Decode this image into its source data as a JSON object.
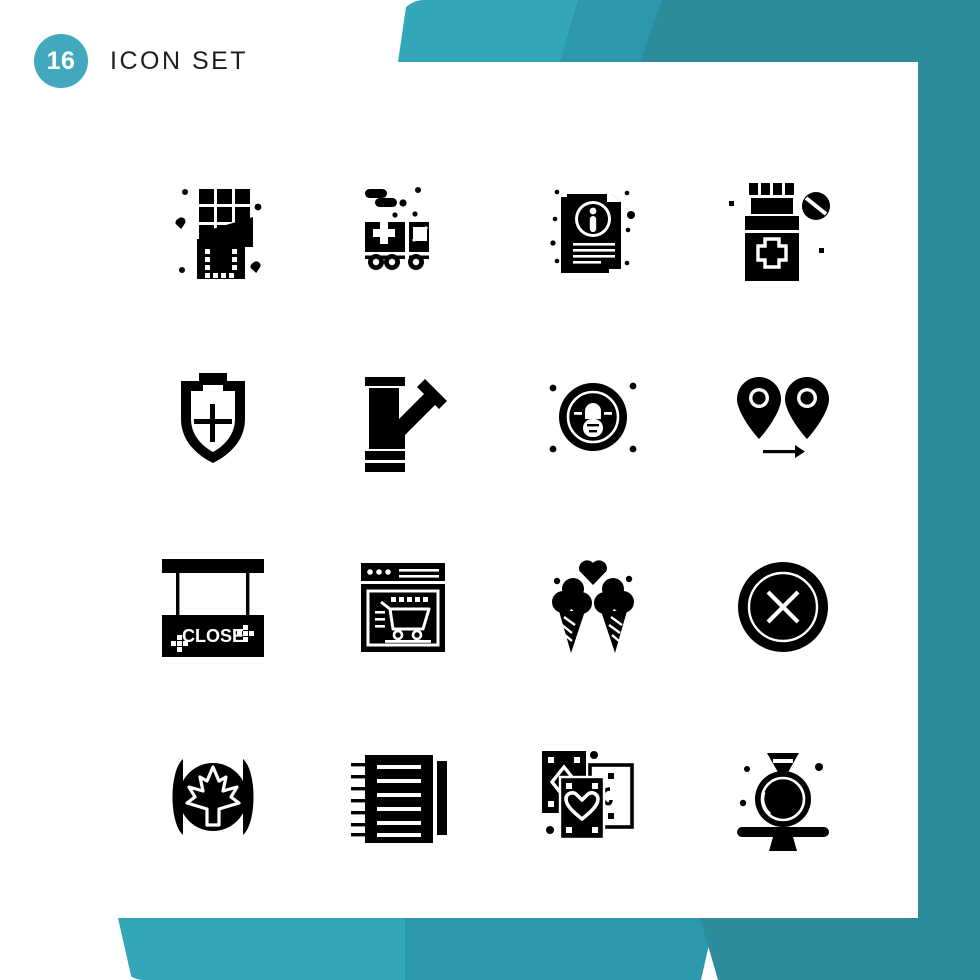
{
  "header": {
    "count": "16",
    "title": "Icon Set"
  },
  "theme": {
    "teal_light": "#33a6b8",
    "teal_mid": "#2b99ab",
    "teal_dark": "#2c8c9c",
    "badge": "#42a8bd",
    "icon_color": "#000000",
    "background": "#ffffff"
  },
  "grid": {
    "columns": 4,
    "rows": 4,
    "icons": [
      {
        "index": 1,
        "name": "chocolate-bar-icon",
        "label": "Chocolate Bar"
      },
      {
        "index": 2,
        "name": "ambulance-icon",
        "label": "Ambulance"
      },
      {
        "index": 3,
        "name": "info-document-icon",
        "label": "Information Document"
      },
      {
        "index": 4,
        "name": "medicine-bottle-icon",
        "label": "Medicine Bottle"
      },
      {
        "index": 5,
        "name": "shield-plus-icon",
        "label": "Medical Shield"
      },
      {
        "index": 6,
        "name": "pipe-joint-icon",
        "label": "Pipe Joint"
      },
      {
        "index": 7,
        "name": "lock-badge-icon",
        "label": "Security Lock"
      },
      {
        "index": 8,
        "name": "map-pins-route-icon",
        "label": "Route Pins"
      },
      {
        "index": 9,
        "name": "close-sign-icon",
        "label": "Close Sign",
        "sign_text": "CLOSE"
      },
      {
        "index": 10,
        "name": "online-shopping-icon",
        "label": "Online Shopping"
      },
      {
        "index": 11,
        "name": "ice-cream-cones-icon",
        "label": "Ice Cream Cones"
      },
      {
        "index": 12,
        "name": "cancel-circle-icon",
        "label": "Cancel"
      },
      {
        "index": 13,
        "name": "maple-leaf-emblem-icon",
        "label": "Maple Leaf Emblem"
      },
      {
        "index": 14,
        "name": "spiral-notebook-icon",
        "label": "Spiral Notebook"
      },
      {
        "index": 15,
        "name": "playing-cards-icon",
        "label": "Playing Cards"
      },
      {
        "index": 16,
        "name": "diamond-ring-icon",
        "label": "Diamond Ring"
      }
    ]
  }
}
